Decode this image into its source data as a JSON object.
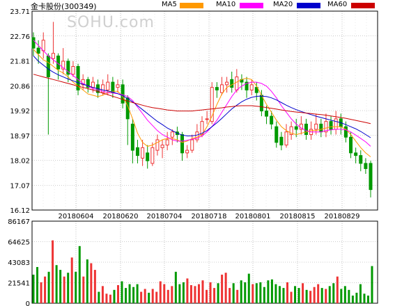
{
  "header": {
    "stock_title": "金卡股份(300349)",
    "watermark": "SOHU.com"
  },
  "legend": [
    {
      "label": "MA5",
      "color": "#ff9900"
    },
    {
      "label": "MA10",
      "color": "#ff00ff"
    },
    {
      "label": "MA20",
      "color": "#0000cc"
    },
    {
      "label": "MA60",
      "color": "#cc0000"
    }
  ],
  "colors": {
    "up": "#ee3333",
    "down": "#009900",
    "grid": "#999999",
    "axis": "#000000"
  },
  "chart_data": [
    {
      "type": "candlestick",
      "title": "",
      "ylim": [
        16.12,
        23.71
      ],
      "y_ticks": [
        "23.71",
        "22.76",
        "21.81",
        "20.86",
        "19.92",
        "18.97",
        "18.02",
        "17.07",
        "16.12"
      ],
      "x_ticks": [
        "20180604",
        "20180620",
        "20180704",
        "20180718",
        "20180801",
        "20180815",
        "20180829"
      ],
      "grid": true,
      "series": [
        {
          "name": "MA5",
          "values": [
            22.25,
            22.05,
            21.85,
            21.75,
            21.6,
            21.45,
            21.35,
            21.2,
            21.0,
            20.85,
            20.7,
            20.55,
            20.5,
            20.45,
            20.5,
            20.6,
            20.65,
            20.65,
            20.45,
            20.1,
            19.6,
            19.05,
            18.7,
            18.55,
            18.6,
            18.7,
            18.8,
            18.85,
            18.85,
            18.8,
            18.7,
            18.75,
            18.85,
            18.9,
            19.0,
            19.3,
            19.7,
            20.15,
            20.55,
            20.8,
            20.9,
            21.0,
            21.1,
            21.15,
            21.1,
            20.85,
            20.5,
            20.15,
            19.85,
            19.55,
            19.3,
            19.15,
            19.05,
            19.0,
            19.05,
            19.1,
            19.15,
            19.15,
            19.2,
            19.25,
            19.3,
            19.3,
            19.3,
            19.2,
            19.0,
            18.75,
            18.5,
            18.3,
            18.15
          ]
        },
        {
          "name": "MA10",
          "values": [
            22.6,
            22.4,
            22.2,
            22.0,
            21.85,
            21.7,
            21.55,
            21.4,
            21.25,
            21.1,
            20.95,
            20.85,
            20.75,
            20.7,
            20.65,
            20.6,
            20.58,
            20.56,
            20.52,
            20.45,
            20.3,
            20.05,
            19.8,
            19.55,
            19.35,
            19.15,
            19.0,
            18.9,
            18.8,
            18.75,
            18.75,
            18.78,
            18.82,
            18.86,
            18.95,
            19.1,
            19.3,
            19.55,
            19.85,
            20.15,
            20.45,
            20.7,
            20.85,
            20.95,
            21.0,
            21.0,
            20.95,
            20.85,
            20.65,
            20.4,
            20.1,
            19.85,
            19.6,
            19.4,
            19.25,
            19.15,
            19.1,
            19.1,
            19.1,
            19.15,
            19.18,
            19.2,
            19.2,
            19.18,
            19.1,
            18.98,
            18.85,
            18.72,
            18.55
          ]
        },
        {
          "name": "MA20",
          "values": [
            22.0,
            21.8,
            21.65,
            21.5,
            21.38,
            21.28,
            21.2,
            21.12,
            21.05,
            20.98,
            20.92,
            20.86,
            20.8,
            20.75,
            20.7,
            20.66,
            20.62,
            20.56,
            20.48,
            20.38,
            20.25,
            20.1,
            19.95,
            19.8,
            19.65,
            19.5,
            19.38,
            19.25,
            19.15,
            19.05,
            18.98,
            18.95,
            18.95,
            18.98,
            19.05,
            19.15,
            19.3,
            19.45,
            19.62,
            19.8,
            19.98,
            20.12,
            20.25,
            20.35,
            20.42,
            20.46,
            20.47,
            20.45,
            20.4,
            20.32,
            20.22,
            20.12,
            20.03,
            19.95,
            19.88,
            19.82,
            19.76,
            19.7,
            19.65,
            19.6,
            19.55,
            19.5,
            19.45,
            19.38,
            19.3,
            19.22,
            19.12,
            19.0,
            18.88
          ]
        },
        {
          "name": "MA60",
          "values": [
            21.3,
            21.25,
            21.2,
            21.15,
            21.1,
            21.05,
            21.0,
            20.95,
            20.9,
            20.85,
            20.8,
            20.75,
            20.7,
            20.64,
            20.58,
            20.52,
            20.46,
            20.4,
            20.34,
            20.28,
            20.22,
            20.17,
            20.12,
            20.07,
            20.03,
            20.0,
            19.97,
            19.94,
            19.92,
            19.9,
            19.9,
            19.9,
            19.9,
            19.92,
            19.94,
            19.96,
            19.98,
            20.0,
            20.02,
            20.05,
            20.07,
            20.09,
            20.1,
            20.1,
            20.1,
            20.08,
            20.06,
            20.03,
            20.0,
            19.97,
            19.94,
            19.91,
            19.88,
            19.86,
            19.84,
            19.82,
            19.8,
            19.78,
            19.76,
            19.74,
            19.71,
            19.68,
            19.65,
            19.62,
            19.58,
            19.54,
            19.5,
            19.46,
            19.42
          ]
        }
      ],
      "candles": [
        [
          22.7,
          22.3,
          22.9,
          22.0
        ],
        [
          22.3,
          22.1,
          22.6,
          21.7
        ],
        [
          22.2,
          22.6,
          22.9,
          21.9
        ],
        [
          22.0,
          21.2,
          22.1,
          19.0
        ],
        [
          21.9,
          22.1,
          23.3,
          21.7
        ],
        [
          22.0,
          21.5,
          22.1,
          21.1
        ],
        [
          21.5,
          21.8,
          22.3,
          21.3
        ],
        [
          21.8,
          21.3,
          21.9,
          21.0
        ],
        [
          21.3,
          21.6,
          21.8,
          21.2
        ],
        [
          21.6,
          20.7,
          21.7,
          20.5
        ],
        [
          20.9,
          21.1,
          21.3,
          20.7
        ],
        [
          21.1,
          20.8,
          21.2,
          20.6
        ],
        [
          20.8,
          21.0,
          21.2,
          20.6
        ],
        [
          20.9,
          20.6,
          21.1,
          20.4
        ],
        [
          20.6,
          20.9,
          21.1,
          20.5
        ],
        [
          20.7,
          21.0,
          21.3,
          20.5
        ],
        [
          21.0,
          20.6,
          21.2,
          20.4
        ],
        [
          20.8,
          20.9,
          21.1,
          20.6
        ],
        [
          20.9,
          20.2,
          21.1,
          20.0
        ],
        [
          20.4,
          19.6,
          20.5,
          18.6
        ],
        [
          19.4,
          18.4,
          19.6,
          17.9
        ],
        [
          18.5,
          18.2,
          18.8,
          17.9
        ],
        [
          18.1,
          18.5,
          18.8,
          17.8
        ],
        [
          18.3,
          18.0,
          18.6,
          17.7
        ],
        [
          17.9,
          18.5,
          18.7,
          17.8
        ],
        [
          18.4,
          18.8,
          19.0,
          18.2
        ],
        [
          18.5,
          18.6,
          18.8,
          18.1
        ],
        [
          18.6,
          18.8,
          19.1,
          18.4
        ],
        [
          18.9,
          19.1,
          19.2,
          18.6
        ],
        [
          19.1,
          19.0,
          19.3,
          18.7
        ],
        [
          19.0,
          18.3,
          19.1,
          18.0
        ],
        [
          18.3,
          18.4,
          18.6,
          18.1
        ],
        [
          18.4,
          18.8,
          19.0,
          18.3
        ],
        [
          18.8,
          19.1,
          19.4,
          18.7
        ],
        [
          19.0,
          19.5,
          19.7,
          18.9
        ],
        [
          19.6,
          19.6,
          19.9,
          19.4
        ],
        [
          19.5,
          20.8,
          21.0,
          19.4
        ],
        [
          20.8,
          20.7,
          21.0,
          20.4
        ],
        [
          20.6,
          20.9,
          21.2,
          20.5
        ],
        [
          20.9,
          21.0,
          21.2,
          20.6
        ],
        [
          21.1,
          20.8,
          21.4,
          20.6
        ],
        [
          20.7,
          21.2,
          21.5,
          20.6
        ],
        [
          21.1,
          21.0,
          21.3,
          20.7
        ],
        [
          21.0,
          20.7,
          21.2,
          20.4
        ],
        [
          20.7,
          20.9,
          21.1,
          20.5
        ],
        [
          20.8,
          20.6,
          21.0,
          20.3
        ],
        [
          20.5,
          19.9,
          20.7,
          19.7
        ],
        [
          19.9,
          19.7,
          20.1,
          19.4
        ],
        [
          19.7,
          19.4,
          19.9,
          19.2
        ],
        [
          19.3,
          18.7,
          19.5,
          18.5
        ],
        [
          18.9,
          18.6,
          19.1,
          18.4
        ],
        [
          18.6,
          19.1,
          19.4,
          18.5
        ],
        [
          19.0,
          19.3,
          19.5,
          18.8
        ],
        [
          19.3,
          19.2,
          19.6,
          18.9
        ],
        [
          19.2,
          19.4,
          19.7,
          19.0
        ],
        [
          19.4,
          19.0,
          19.6,
          18.8
        ],
        [
          19.0,
          19.2,
          19.5,
          18.8
        ],
        [
          19.2,
          19.4,
          19.8,
          19.0
        ],
        [
          19.4,
          19.1,
          19.6,
          18.9
        ],
        [
          19.1,
          19.5,
          19.8,
          18.9
        ],
        [
          19.5,
          19.2,
          19.7,
          19.0
        ],
        [
          19.2,
          19.6,
          19.9,
          19.0
        ],
        [
          19.6,
          19.3,
          19.8,
          19.0
        ],
        [
          19.3,
          18.9,
          19.5,
          18.7
        ],
        [
          18.9,
          18.3,
          19.1,
          18.1
        ],
        [
          18.3,
          18.2,
          18.5,
          17.9
        ],
        [
          18.2,
          17.9,
          18.4,
          17.6
        ],
        [
          17.9,
          17.7,
          18.1,
          17.5
        ],
        [
          17.9,
          16.9,
          18.0,
          16.6
        ]
      ]
    },
    {
      "type": "bar",
      "title": "",
      "ylim": [
        0,
        86167
      ],
      "y_ticks": [
        "86167",
        "64625",
        "43083",
        "21541",
        "0"
      ],
      "values": [
        30000,
        38000,
        22000,
        28000,
        33000,
        66000,
        40000,
        35000,
        28000,
        32000,
        48000,
        33000,
        60000,
        28000,
        46000,
        42000,
        35000,
        12000,
        18000,
        10000,
        9000,
        14000,
        19000,
        23000,
        16000,
        20000,
        17000,
        20000,
        12000,
        15000,
        11000,
        15000,
        12000,
        23000,
        20000,
        14000,
        18000,
        33000,
        20000,
        22000,
        26000,
        19000,
        18000,
        20000,
        24000,
        14000,
        22000,
        16000,
        21000,
        30000,
        32000,
        16000,
        21000,
        14000,
        24000,
        22000,
        31000,
        20000,
        21000,
        22000,
        17000,
        24000,
        25000,
        20000,
        18000,
        16000,
        22000,
        12000,
        18000,
        16000,
        21000,
        14000,
        13000,
        17000,
        20000,
        16000,
        15000,
        18000,
        21000,
        28000,
        15000,
        18000,
        14000,
        8000,
        11000,
        20000,
        10000,
        8000,
        39000
      ]
    }
  ]
}
